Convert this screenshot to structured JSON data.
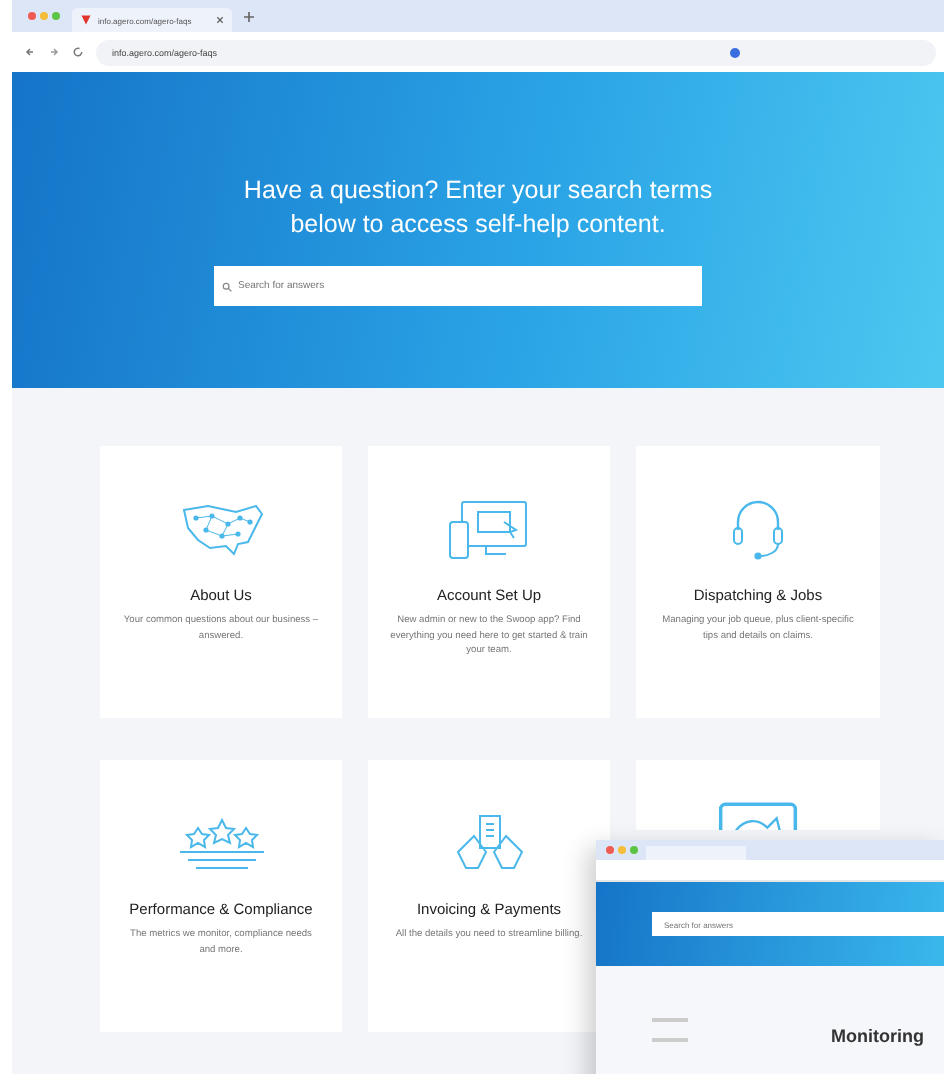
{
  "browser": {
    "tab_title": "info.agero.com/agero-faqs",
    "url": "info.agero.com/agero-faqs"
  },
  "hero": {
    "heading": "Have a question? Enter your search terms below to access self-help content.",
    "search": {
      "placeholder": "Search for answers"
    }
  },
  "cards": [
    {
      "kind": "map",
      "title": "About Us",
      "description": "Your common questions about our business – answered."
    },
    {
      "kind": "devices",
      "title": "Account Set Up",
      "description": "New admin or new to the Swoop app? Find everything you need here to get started & train your team."
    },
    {
      "kind": "headset",
      "title": "Dispatching & Jobs",
      "description": "Managing your job queue, plus client-specific tips and details on claims."
    },
    {
      "kind": "stars",
      "title": "Performance & Compliance",
      "description": "The metrics we monitor, compliance needs and more."
    },
    {
      "kind": "invoice",
      "title": "Invoicing & Payments",
      "description": "All the details you need to streamline billing."
    },
    {
      "kind": "screen"
    }
  ],
  "second_window": {
    "search": {
      "placeholder": "Search for answers"
    },
    "heading": "Monitoring"
  }
}
